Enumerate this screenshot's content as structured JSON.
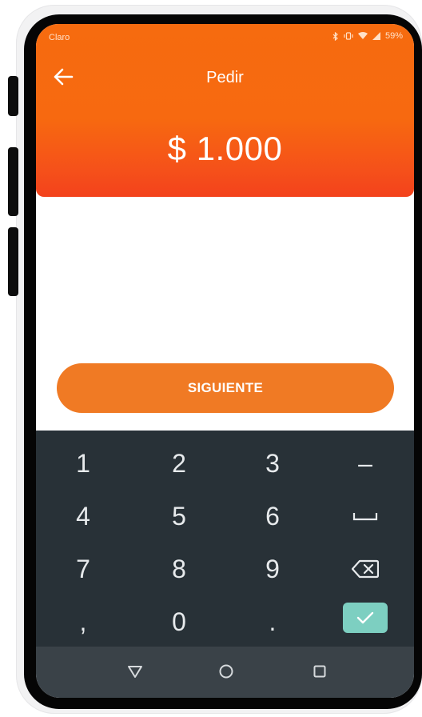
{
  "status_bar": {
    "carrier": "Claro",
    "battery": "59%"
  },
  "header": {
    "title": "Pedir",
    "amount": "$ 1.000"
  },
  "actions": {
    "next_label": "SIGUIENTE"
  },
  "keyboard": {
    "k1": "1",
    "k2": "2",
    "k3": "3",
    "k4": "4",
    "k5": "5",
    "k6": "6",
    "k7": "7",
    "k8": "8",
    "k9": "9",
    "k0": "0",
    "comma": ",",
    "period": ".",
    "minus": "–",
    "space_icon": "space-bar-icon",
    "backspace_icon": "backspace-icon",
    "done_icon": "checkmark-icon"
  },
  "navigation": {
    "back_icon": "triangle-back-icon",
    "home_icon": "circle-home-icon",
    "recents_icon": "square-recents-icon"
  },
  "colors": {
    "header_orange": "#f66b0f",
    "header_red": "#f3421c",
    "button_orange": "#f07a24",
    "keyboard_bg": "#283137",
    "navbar_bg": "#3a4248",
    "confirm_teal": "#7dcfc1"
  }
}
